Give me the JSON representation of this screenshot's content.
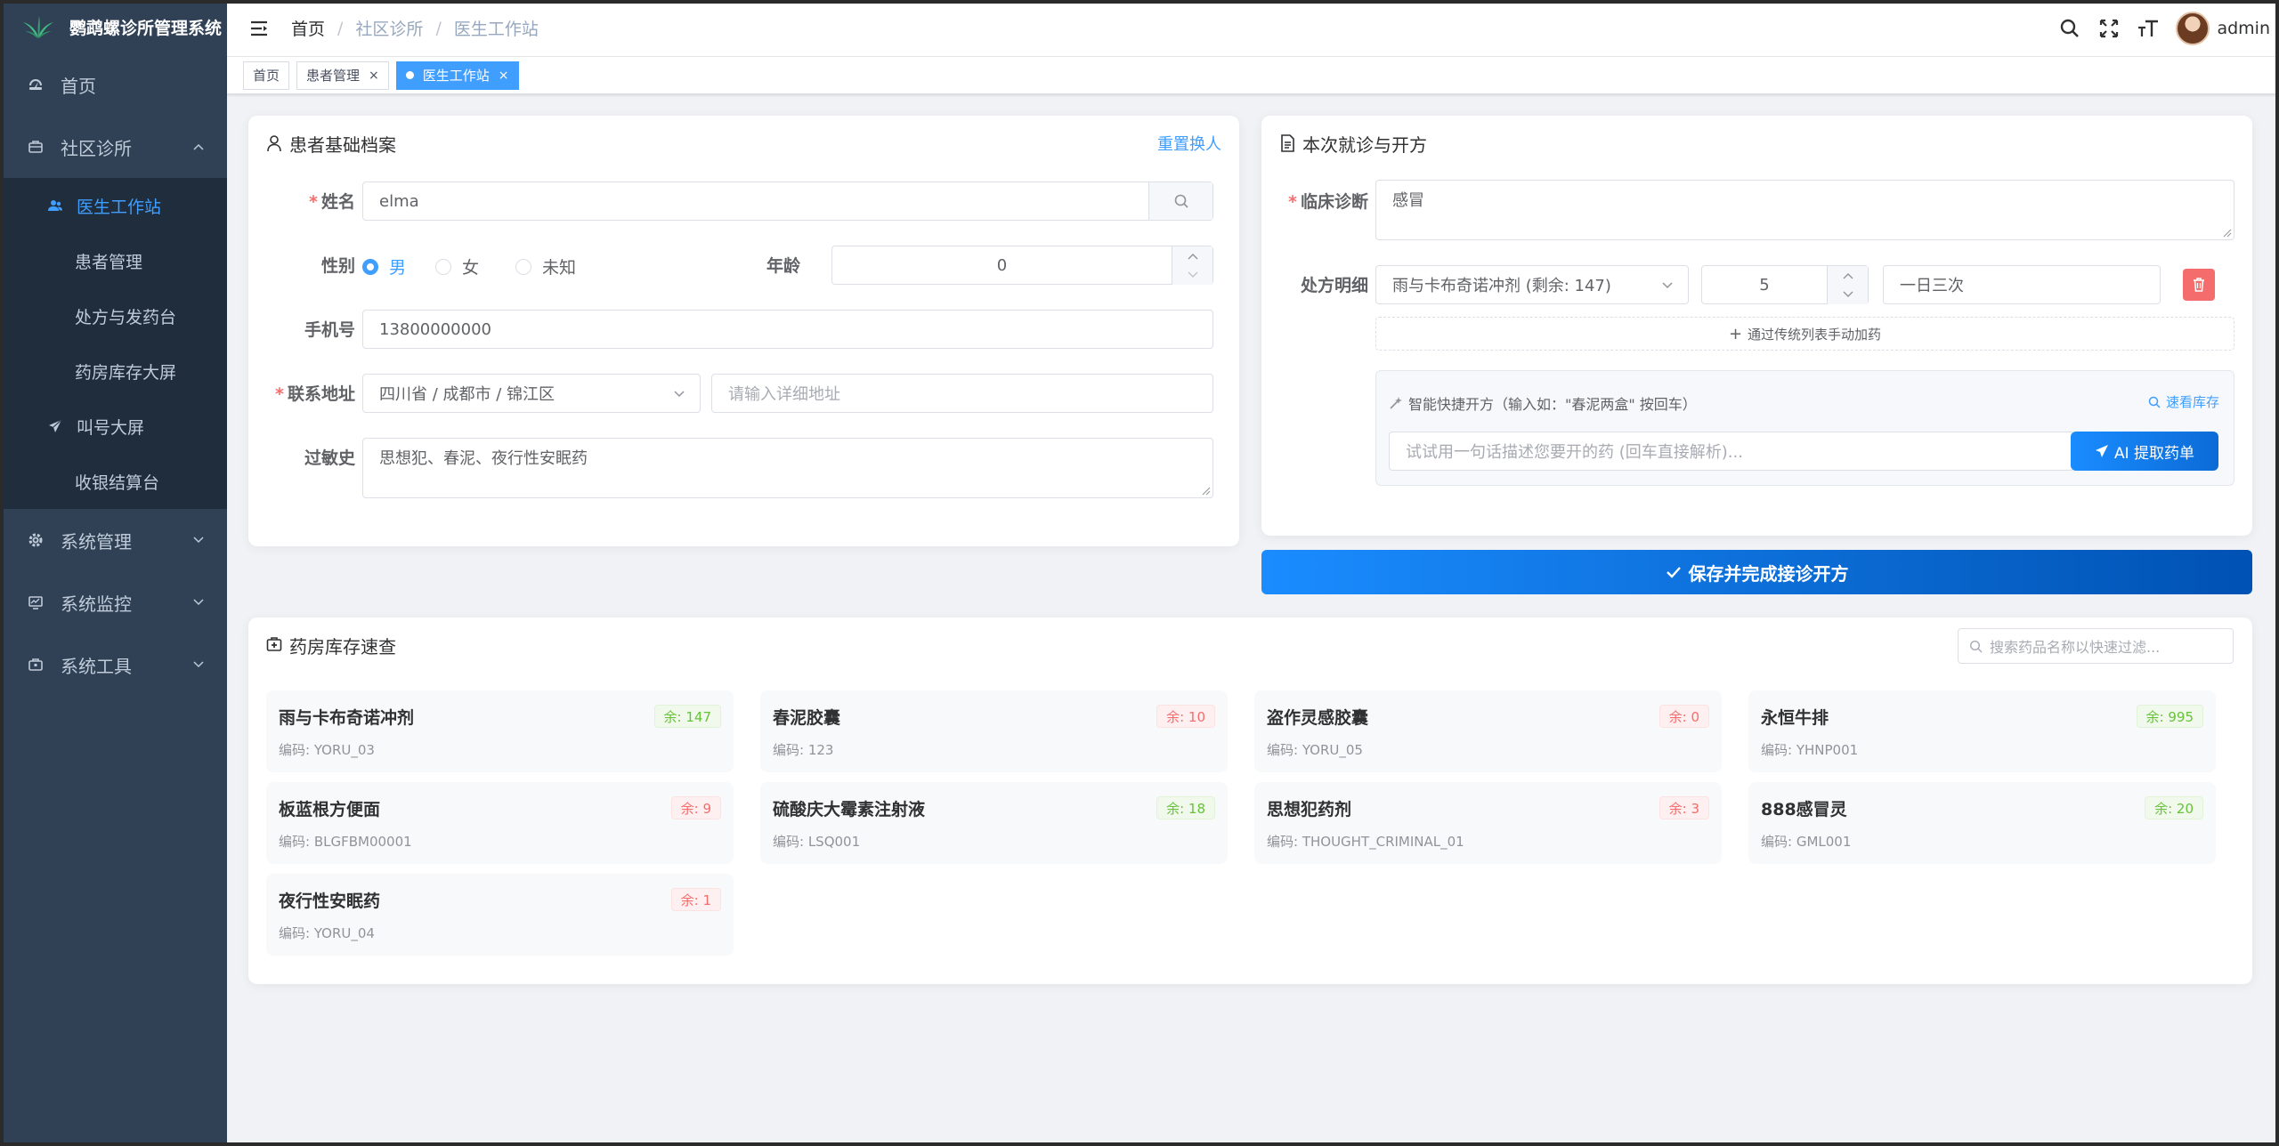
{
  "app": {
    "title": "鹦鹉螺诊所管理系统"
  },
  "sidebar": {
    "items": [
      {
        "label": "首页"
      },
      {
        "label": "社区诊所"
      },
      {
        "label": "系统管理"
      },
      {
        "label": "系统监控"
      },
      {
        "label": "系统工具"
      }
    ],
    "sub_items": [
      {
        "label": "医生工作站"
      },
      {
        "label": "患者管理"
      },
      {
        "label": "处方与发药台"
      },
      {
        "label": "药房库存大屏"
      },
      {
        "label": "叫号大屏"
      },
      {
        "label": "收银结算台"
      }
    ]
  },
  "breadcrumb": {
    "home": "首页",
    "level1": "社区诊所",
    "level2": "医生工作站"
  },
  "header": {
    "username": "admin"
  },
  "tags": [
    {
      "label": "首页"
    },
    {
      "label": "患者管理"
    },
    {
      "label": "医生工作站"
    }
  ],
  "patient_card": {
    "title": "患者基础档案",
    "reset_link": "重置换人",
    "name_label": "姓名",
    "name_value": "elma",
    "gender_label": "性别",
    "gender_options": [
      "男",
      "女",
      "未知"
    ],
    "gender_selected": "男",
    "age_label": "年龄",
    "age_value": "0",
    "phone_label": "手机号",
    "phone_value": "13800000000",
    "address_label": "联系地址",
    "address_region": "四川省 / 成都市 / 锦江区",
    "address_detail_placeholder": "请输入详细地址",
    "allergy_label": "过敏史",
    "allergy_value": "思想犯、春泥、夜行性安眠药"
  },
  "visit_card": {
    "title": "本次就诊与开方",
    "diagnosis_label": "临床诊断",
    "diagnosis_value": "感冒",
    "rx_label": "处方明细",
    "rx_drug": "雨与卡布奇诺冲剂 (剩余: 147)",
    "rx_qty": "5",
    "rx_freq": "一日三次",
    "add_manual": "通过传统列表手动加药",
    "smart_title": "智能快捷开方（输入如：\"春泥两盒\" 按回车）",
    "smart_link": "速看库存",
    "smart_placeholder": "试试用一句话描述您要开的药 (回车直接解析)...",
    "ai_button": "AI 提取药单"
  },
  "save_button": "保存并完成接诊开方",
  "inventory": {
    "title": "药房库存速查",
    "search_placeholder": "搜索药品名称以快速过滤...",
    "drugs": [
      {
        "name": "雨与卡布奇诺冲剂",
        "code": "编码: YORU_03",
        "stock": "余: 147",
        "level": "ok"
      },
      {
        "name": "春泥胶囊",
        "code": "编码: 123",
        "stock": "余: 10",
        "level": "low"
      },
      {
        "name": "盗作灵感胶囊",
        "code": "编码: YORU_05",
        "stock": "余: 0",
        "level": "low"
      },
      {
        "name": "永恒牛排",
        "code": "编码: YHNP001",
        "stock": "余: 995",
        "level": "ok"
      },
      {
        "name": "板蓝根方便面",
        "code": "编码: BLGFBM00001",
        "stock": "余: 9",
        "level": "low"
      },
      {
        "name": "硫酸庆大霉素注射液",
        "code": "编码: LSQ001",
        "stock": "余: 18",
        "level": "ok"
      },
      {
        "name": "思想犯药剂",
        "code": "编码: THOUGHT_CRIMINAL_01",
        "stock": "余: 3",
        "level": "low"
      },
      {
        "name": "888感冒灵",
        "code": "编码: GML001",
        "stock": "余: 20",
        "level": "ok"
      },
      {
        "name": "夜行性安眠药",
        "code": "编码: YORU_04",
        "stock": "余: 1",
        "level": "low"
      }
    ]
  },
  "colors": {
    "primary": "#409eff",
    "sidebar_bg": "#304156",
    "danger": "#f56c6c",
    "success": "#67c23a"
  }
}
